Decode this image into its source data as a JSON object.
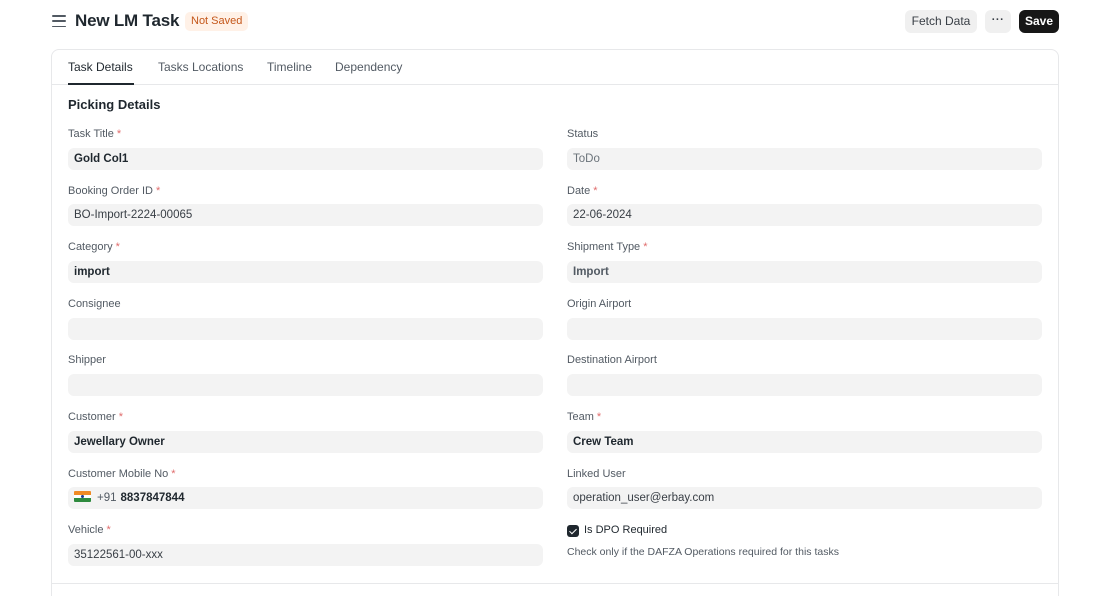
{
  "header": {
    "title": "New LM Task",
    "status": "Not Saved",
    "fetch_label": "Fetch Data",
    "more_label": "···",
    "save_label": "Save"
  },
  "tabs": [
    {
      "label": "Task Details",
      "active": true
    },
    {
      "label": "Tasks Locations",
      "active": false
    },
    {
      "label": "Timeline",
      "active": false
    },
    {
      "label": "Dependency",
      "active": false
    }
  ],
  "section": {
    "title": "Picking Details"
  },
  "fields": {
    "task_title": {
      "label": "Task Title",
      "required": "*",
      "value": "Gold Col1"
    },
    "status": {
      "label": "Status",
      "value": "ToDo"
    },
    "booking_order_id": {
      "label": "Booking Order ID",
      "required": "*",
      "value": "BO-Import-2224-00065"
    },
    "date": {
      "label": "Date",
      "required": "*",
      "value": "22-06-2024"
    },
    "category": {
      "label": "Category",
      "required": "*",
      "value": "import"
    },
    "shipment_type": {
      "label": "Shipment Type",
      "required": "*",
      "value": "Import"
    },
    "consignee": {
      "label": "Consignee",
      "value": ""
    },
    "origin_airport": {
      "label": "Origin Airport",
      "value": ""
    },
    "shipper": {
      "label": "Shipper",
      "value": ""
    },
    "destination_airport": {
      "label": "Destination Airport",
      "value": ""
    },
    "customer": {
      "label": "Customer",
      "required": "*",
      "value": "Jewellary Owner"
    },
    "team": {
      "label": "Team",
      "required": "*",
      "value": "Crew Team"
    },
    "customer_mobile": {
      "label": "Customer Mobile No",
      "required": "*",
      "country_code": "+91",
      "value": "8837847844",
      "flag_icon": "india-flag-icon"
    },
    "linked_user": {
      "label": "Linked User",
      "value": "operation_user@erbay.com"
    },
    "vehicle": {
      "label": "Vehicle",
      "required": "*",
      "value": "35122561-00-xxx"
    },
    "is_dpo_required": {
      "label": "Is DPO Required",
      "checked": true,
      "help": "Check only if the DAFZA Operations required for this tasks"
    }
  },
  "colors": {
    "accent": "#171717",
    "status_bg": "#fff1e7",
    "status_text": "#c4571a",
    "input_bg": "#f3f3f3",
    "required": "#e06c6c"
  }
}
